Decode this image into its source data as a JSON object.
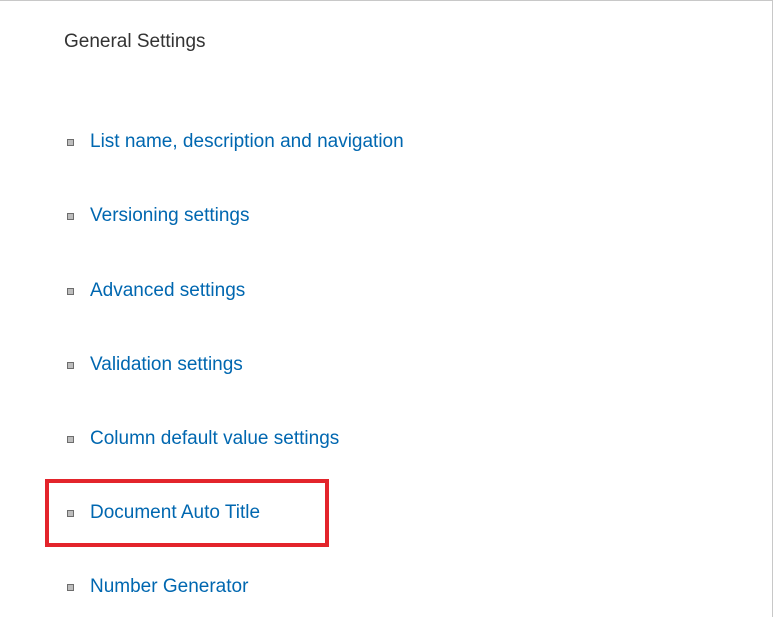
{
  "section": {
    "title": "General Settings"
  },
  "settings_links": [
    {
      "label": "List name, description and navigation"
    },
    {
      "label": "Versioning settings"
    },
    {
      "label": "Advanced settings"
    },
    {
      "label": "Validation settings"
    },
    {
      "label": "Column default value settings"
    },
    {
      "label": "Document Auto Title"
    },
    {
      "label": "Number Generator"
    }
  ],
  "highlight": {
    "target_label": "Document Auto Title",
    "color": "#e3242b"
  },
  "colors": {
    "link": "#0067b0",
    "title": "#333333"
  }
}
